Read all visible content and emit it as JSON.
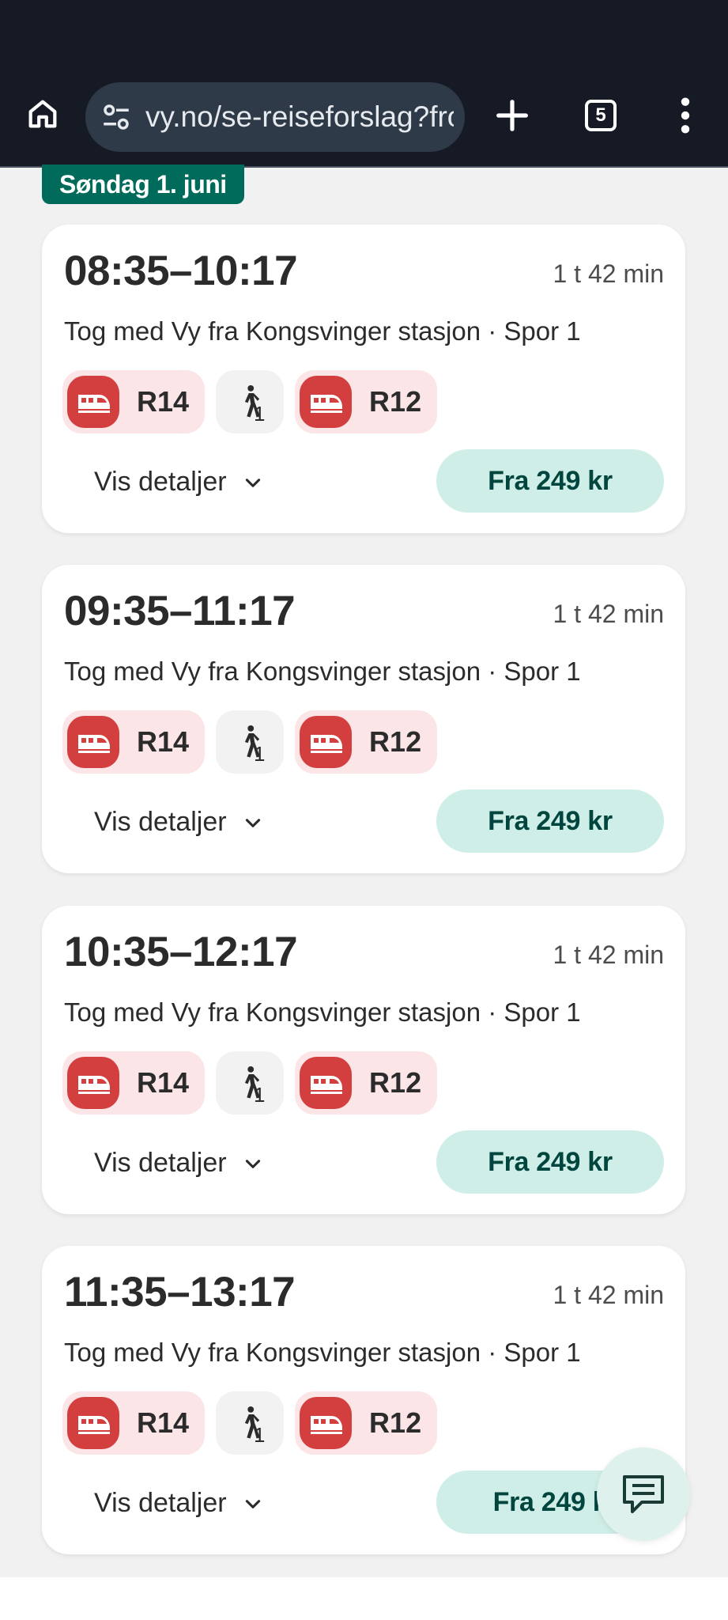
{
  "browser": {
    "url": "vy.no/se-reiseforslag?fro",
    "tab_count": "5"
  },
  "date_header": "Søndag 1. juni",
  "trips": [
    {
      "times": "08:35–10:17",
      "duration": "1 t 42 min",
      "description": "Tog med Vy fra Kongsvinger stasjon · Spor 1",
      "legs": [
        "R14",
        "1",
        "R12"
      ],
      "details_label": "Vis detaljer",
      "price_label": "Fra 249 kr"
    },
    {
      "times": "09:35–11:17",
      "duration": "1 t 42 min",
      "description": "Tog med Vy fra Kongsvinger stasjon · Spor 1",
      "legs": [
        "R14",
        "1",
        "R12"
      ],
      "details_label": "Vis detaljer",
      "price_label": "Fra 249 kr"
    },
    {
      "times": "10:35–12:17",
      "duration": "1 t 42 min",
      "description": "Tog med Vy fra Kongsvinger stasjon · Spor 1",
      "legs": [
        "R14",
        "1",
        "R12"
      ],
      "details_label": "Vis detaljer",
      "price_label": "Fra 249 kr"
    },
    {
      "times": "11:35–13:17",
      "duration": "1 t 42 min",
      "description": "Tog med Vy fra Kongsvinger stasjon · Spor 1",
      "legs": [
        "R14",
        "1",
        "R12"
      ],
      "details_label": "Vis detaljer",
      "price_label": "Fra 249 k"
    }
  ],
  "colors": {
    "browser_bg": "#151a24",
    "accent_green": "#006a5b",
    "price_bg": "#cfeee7",
    "train_red": "#d33f3f",
    "train_chip_bg": "#fbe5e6"
  },
  "icons": [
    "home-icon",
    "site-settings-icon",
    "plus-icon",
    "tab-switcher-icon",
    "more-vert-icon",
    "train-icon",
    "walk-icon",
    "chevron-down-icon",
    "chat-icon"
  ]
}
